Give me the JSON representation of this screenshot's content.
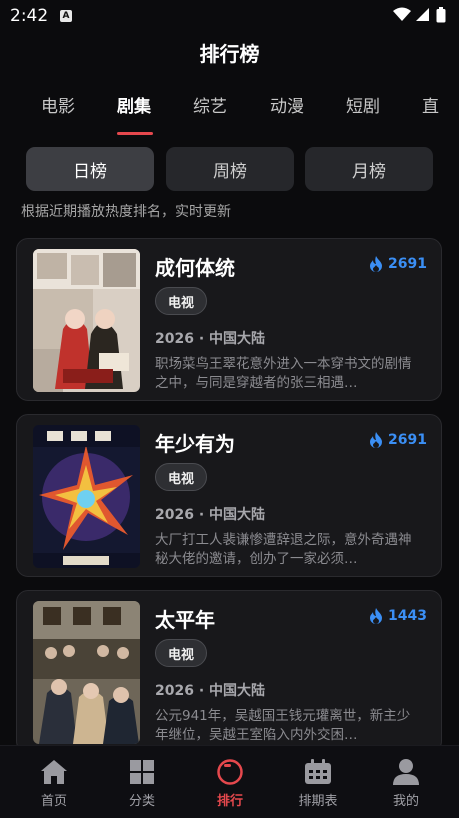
{
  "status_bar": {
    "time": "2:42",
    "notification_icon": "A"
  },
  "header": {
    "title": "排行榜"
  },
  "category_tabs": [
    "电影",
    "剧集",
    "综艺",
    "动漫",
    "短剧",
    "直"
  ],
  "active_tab": "剧集",
  "period_tabs": [
    "日榜",
    "周榜",
    "月榜"
  ],
  "active_period": "日榜",
  "subtitle": "根据近期播放热度排名，实时更新",
  "items": [
    {
      "title": "成何体统",
      "heat": "2691",
      "badge": "电视",
      "meta": "2026 · 中国大陆",
      "desc": "职场菜鸟王翠花意外进入一本穿书文的剧情之中，与同是穿越者的张三相遇…"
    },
    {
      "title": "年少有为",
      "heat": "2691",
      "badge": "电视",
      "meta": "2026 · 中国大陆",
      "desc": "大厂打工人裴谦惨遭辞退之际，意外奇遇神秘大佬的邀请，创办了一家必须…"
    },
    {
      "title": "太平年",
      "heat": "1443",
      "badge": "电视",
      "meta": "2026 · 中国大陆",
      "desc": "公元941年，吴越国王钱元瓘离世，新主少年继位，吴越王室陷入内外交困…"
    }
  ],
  "bottom_nav": [
    {
      "label": "首页",
      "icon": "home-icon"
    },
    {
      "label": "分类",
      "icon": "grid-icon"
    },
    {
      "label": "排行",
      "icon": "ranking-icon"
    },
    {
      "label": "排期表",
      "icon": "calendar-icon"
    },
    {
      "label": "我的",
      "icon": "person-icon"
    }
  ],
  "active_nav": "排行",
  "colors": {
    "accent": "#e5484d",
    "heat": "#3b8ff5",
    "background": "#0b0b0d",
    "card": "#18181b"
  }
}
